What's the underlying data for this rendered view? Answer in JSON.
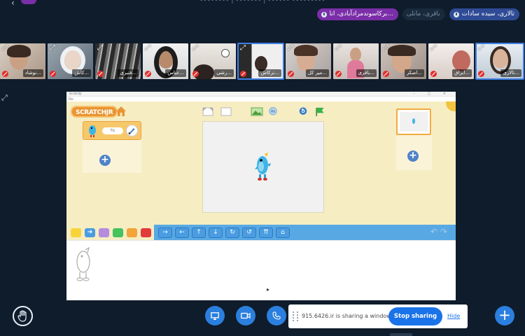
{
  "top": {
    "status_text": "•••••••• | ••••••• | •••••• •••••••••",
    "caret": "‹",
    "speakers": [
      "برکاسوندمرادآبادی، انا...",
      "باقری، مانلی",
      "تالاری، سیده سادات"
    ]
  },
  "participants": [
    {
      "name": "نوشاد..."
    },
    {
      "name": "کاش..."
    },
    {
      "name": "قنبری..."
    },
    {
      "name": "عباس..."
    },
    {
      "name": "رشی..."
    },
    {
      "name": "ترکاش..."
    },
    {
      "name": "میر کل..."
    },
    {
      "name": "باقری..."
    },
    {
      "name": "اصکر..."
    },
    {
      "name": "ابراق..."
    },
    {
      "name": "تالاری..."
    }
  ],
  "tile_icons": {
    "expand": "⤢"
  },
  "fullscreen_glyph": "⤢",
  "shared_window": {
    "title": "ScratchJr",
    "menu": "File",
    "controls": "– □ ×",
    "logo": "SCRATCHJR",
    "sprite_name": "Tic",
    "add_glyph": "+",
    "undo_redo": "↶↷",
    "cursor": "▸"
  },
  "colors": {
    "motion_blocks": "#4a9de1",
    "share_button": "#1a73e8",
    "call_controls": "#2b7fde",
    "speaker_purple": "#7a2ea8",
    "speaker_blue": "#2f4b95"
  },
  "sharing": {
    "message": "915.6426.ir is sharing a window.",
    "stop_label": "Stop sharing",
    "hide_label": "Hide"
  },
  "fab_label": "+"
}
